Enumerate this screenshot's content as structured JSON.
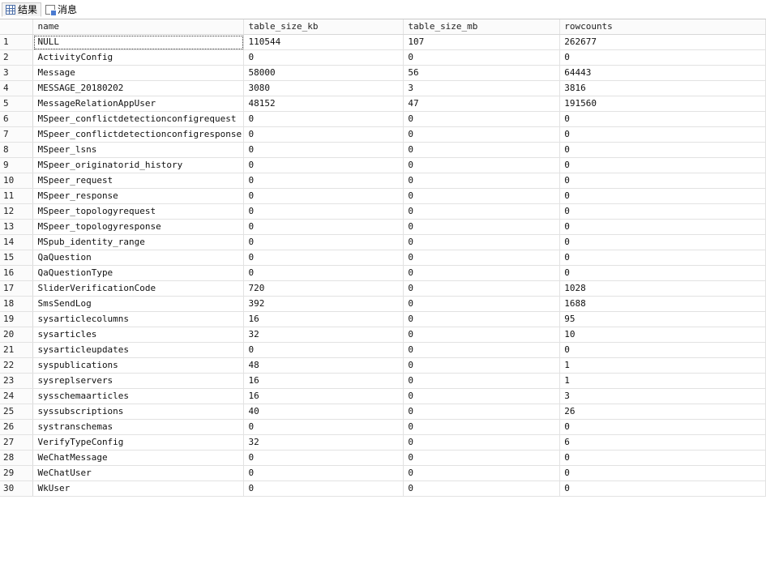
{
  "tabs": [
    {
      "label": "结果",
      "icon": "results-grid-icon",
      "active": true
    },
    {
      "label": "消息",
      "icon": "messages-icon",
      "active": false
    }
  ],
  "columns": [
    "name",
    "table_size_kb",
    "table_size_mb",
    "rowcounts"
  ],
  "rows": [
    [
      "1",
      "NULL",
      "110544",
      "107",
      "262677"
    ],
    [
      "2",
      "ActivityConfig",
      "0",
      "0",
      "0"
    ],
    [
      "3",
      "Message",
      "58000",
      "56",
      "64443"
    ],
    [
      "4",
      "MESSAGE_20180202",
      "3080",
      "3",
      "3816"
    ],
    [
      "5",
      "MessageRelationAppUser",
      "48152",
      "47",
      "191560"
    ],
    [
      "6",
      "MSpeer_conflictdetectionconfigrequest",
      "0",
      "0",
      "0"
    ],
    [
      "7",
      "MSpeer_conflictdetectionconfigresponse",
      "0",
      "0",
      "0"
    ],
    [
      "8",
      "MSpeer_lsns",
      "0",
      "0",
      "0"
    ],
    [
      "9",
      "MSpeer_originatorid_history",
      "0",
      "0",
      "0"
    ],
    [
      "10",
      "MSpeer_request",
      "0",
      "0",
      "0"
    ],
    [
      "11",
      "MSpeer_response",
      "0",
      "0",
      "0"
    ],
    [
      "12",
      "MSpeer_topologyrequest",
      "0",
      "0",
      "0"
    ],
    [
      "13",
      "MSpeer_topologyresponse",
      "0",
      "0",
      "0"
    ],
    [
      "14",
      "MSpub_identity_range",
      "0",
      "0",
      "0"
    ],
    [
      "15",
      "QaQuestion",
      "0",
      "0",
      "0"
    ],
    [
      "16",
      "QaQuestionType",
      "0",
      "0",
      "0"
    ],
    [
      "17",
      "SliderVerificationCode",
      "720",
      "0",
      "1028"
    ],
    [
      "18",
      "SmsSendLog",
      "392",
      "0",
      "1688"
    ],
    [
      "19",
      "sysarticlecolumns",
      "16",
      "0",
      "95"
    ],
    [
      "20",
      "sysarticles",
      "32",
      "0",
      "10"
    ],
    [
      "21",
      "sysarticleupdates",
      "0",
      "0",
      "0"
    ],
    [
      "22",
      "syspublications",
      "48",
      "0",
      "1"
    ],
    [
      "23",
      "sysreplservers",
      "16",
      "0",
      "1"
    ],
    [
      "24",
      "sysschemaarticles",
      "16",
      "0",
      "3"
    ],
    [
      "25",
      "syssubscriptions",
      "40",
      "0",
      "26"
    ],
    [
      "26",
      "systranschemas",
      "0",
      "0",
      "0"
    ],
    [
      "27",
      "VerifyTypeConfig",
      "32",
      "0",
      "6"
    ],
    [
      "28",
      "WeChatMessage",
      "0",
      "0",
      "0"
    ],
    [
      "29",
      "WeChatUser",
      "0",
      "0",
      "0"
    ],
    [
      "30",
      "WkUser",
      "0",
      "0",
      "0"
    ]
  ]
}
